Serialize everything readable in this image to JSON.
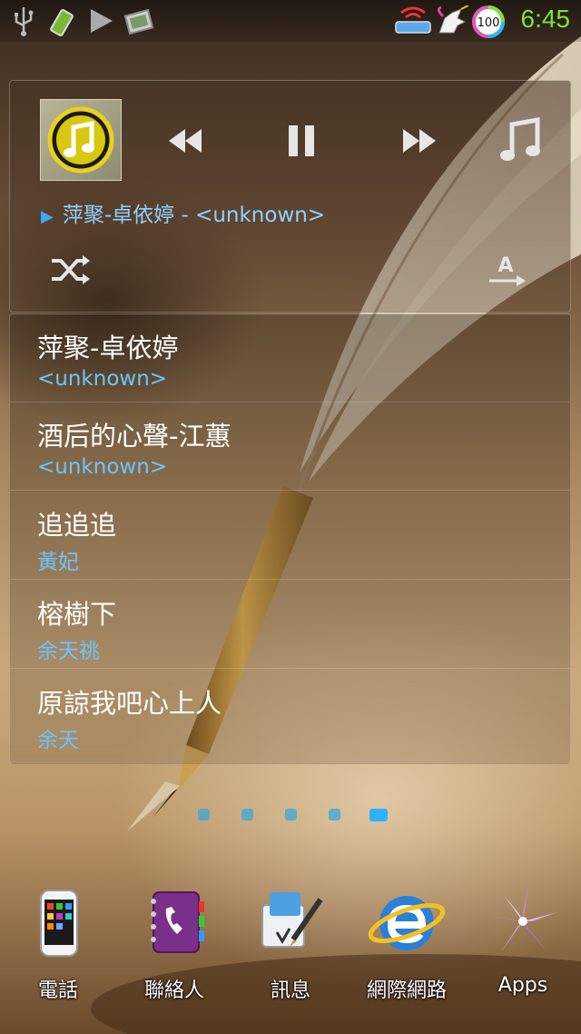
{
  "status_bar": {
    "left_icons": [
      "usb-icon",
      "battery-saver-icon",
      "play-store-icon",
      "gallery-icon"
    ],
    "right_icons": [
      "wifi-router-icon",
      "unicorn-icon",
      "battery-ring-icon"
    ],
    "battery_percent": "100",
    "time": "6:45",
    "time_color": "#7ee13a"
  },
  "music_widget": {
    "album_art_icon": "music-note-icon",
    "controls": [
      "rewind-icon",
      "pause-icon",
      "fast-forward-icon",
      "music-note-icon"
    ],
    "now_playing": "萍聚-卓依婷 - <unknown>",
    "shuffle_icon": "shuffle-icon",
    "text_icon": "text-direction-icon",
    "accent_color": "#3aa8ff"
  },
  "playlist": {
    "tracks": [
      {
        "title": "萍聚-卓依婷",
        "artist": "<unknown>"
      },
      {
        "title": "酒后的心聲-江蕙",
        "artist": "<unknown>"
      },
      {
        "title": "追追追",
        "artist": "黃妃"
      },
      {
        "title": "榕樹下",
        "artist": "余天祧"
      },
      {
        "title": "原諒我吧心上人",
        "artist": "余天"
      }
    ]
  },
  "page_indicator": {
    "count": 5,
    "active": 5
  },
  "dock": {
    "items": [
      {
        "label": "電話",
        "icon": "phone-icon"
      },
      {
        "label": "聯絡人",
        "icon": "contacts-icon"
      },
      {
        "label": "訊息",
        "icon": "messaging-icon"
      },
      {
        "label": "網際網路",
        "icon": "internet-icon"
      },
      {
        "label": "Apps",
        "icon": "apps-icon"
      }
    ]
  }
}
